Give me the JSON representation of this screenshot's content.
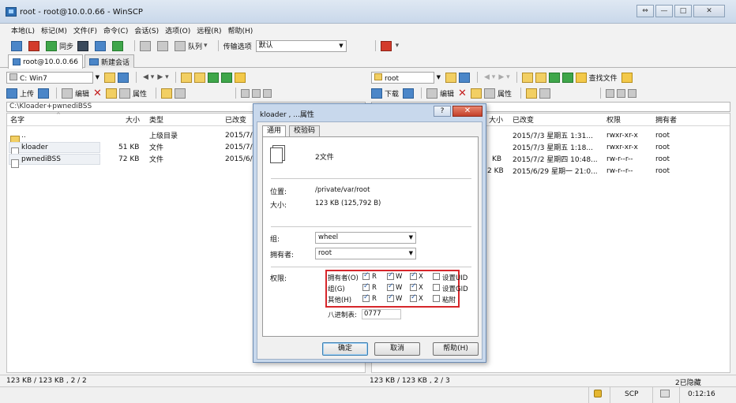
{
  "window": {
    "title": "root - root@10.0.0.66 - WinSCP",
    "controls": [
      "⇔",
      "—",
      "□",
      "✕"
    ]
  },
  "menu": [
    "本地(L)",
    "标记(M)",
    "文件(F)",
    "命令(C)",
    "会话(S)",
    "选项(O)",
    "远程(R)",
    "帮助(H)"
  ],
  "toolbar": {
    "sync_label": "同步",
    "queue_label": "队列",
    "transfer_label": "传输选项",
    "transfer_value": "默认"
  },
  "session_tabs": {
    "active": "root@10.0.0.66",
    "new": "新建会话"
  },
  "left_panel": {
    "drive": "C: Win7",
    "toolbar": {
      "upload": "上传",
      "edit": "编辑",
      "props": "属性"
    },
    "path": "C:\\Kloader+pwnediBSS",
    "columns": {
      "name": "名字",
      "size": "大小",
      "type": "类型",
      "changed": "已改变"
    },
    "rows": [
      {
        "name": "..",
        "size": "",
        "type": "上级目录",
        "changed": "2015/7/"
      },
      {
        "name": "kloader",
        "size": "51 KB",
        "type": "文件",
        "changed": "2015/7/"
      },
      {
        "name": "pwnediBSS",
        "size": "72 KB",
        "type": "文件",
        "changed": "2015/6/"
      }
    ],
    "status": "123 KB / 123 KB , 2 / 2"
  },
  "right_panel": {
    "folder": "root",
    "toolbar": {
      "download": "下载",
      "edit": "编辑",
      "props": "属性",
      "find": "查找文件"
    },
    "columns": {
      "size": "大小",
      "changed": "已改变",
      "rights": "权限",
      "owner": "拥有者"
    },
    "rows": [
      {
        "size": "",
        "changed": "2015/7/3 星期五 1:31...",
        "rights": "rwxr-xr-x",
        "owner": "root"
      },
      {
        "size": "",
        "changed": "2015/7/3 星期五 1:18...",
        "rights": "rwxr-xr-x",
        "owner": "root"
      },
      {
        "size": "KB",
        "changed": "2015/7/2 星期四 10:48...",
        "rights": "rw-r--r--",
        "owner": "root"
      },
      {
        "size": "2 KB",
        "changed": "2015/6/29 星期一 21:0...",
        "rights": "rw-r--r--",
        "owner": "root"
      }
    ],
    "status": "123 KB / 123 KB , 2 / 3"
  },
  "statusbar": {
    "hidden": "2已隐藏",
    "protocol": "SCP",
    "time": "0:12:16"
  },
  "dialog": {
    "title": "kloader , ...属性",
    "help_btn": "?",
    "close_btn": "✕",
    "tabs": [
      "通用",
      "校验码"
    ],
    "file_count": "2文件",
    "location_label": "位置:",
    "location": "/private/var/root",
    "size_label": "大小:",
    "size": "123 KB (125,792 B)",
    "group_label": "组:",
    "group": "wheel",
    "owner_label": "拥有者:",
    "owner": "root",
    "rights_label": "权限:",
    "perm_rows": [
      {
        "label": "拥有者(O)",
        "r": true,
        "w": true,
        "x": true,
        "special": "设置UID"
      },
      {
        "label": "组(G)",
        "r": true,
        "w": true,
        "x": true,
        "special": "设置GID"
      },
      {
        "label": "其他(H)",
        "r": true,
        "w": true,
        "x": true,
        "special": "粘附"
      }
    ],
    "perm_letters": {
      "r": "R",
      "w": "W",
      "x": "X"
    },
    "octal_label": "八进制表:",
    "octal": "0777",
    "ok": "确定",
    "cancel": "取消",
    "help": "帮助(H)"
  }
}
